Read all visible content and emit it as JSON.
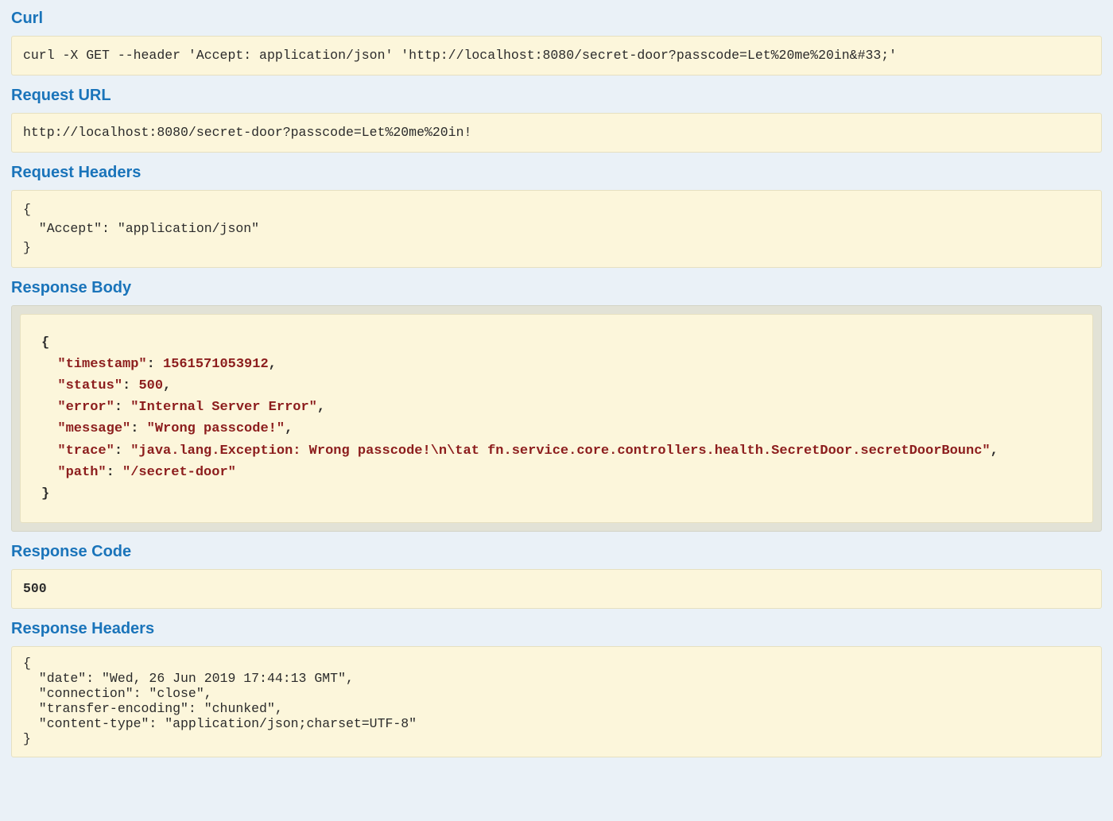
{
  "sections": {
    "curl": {
      "title": "Curl",
      "content": "curl -X GET --header 'Accept: application/json' 'http://localhost:8080/secret-door?passcode=Let%20me%20in&#33;'"
    },
    "requestUrl": {
      "title": "Request URL",
      "content": "http://localhost:8080/secret-door?passcode=Let%20me%20in!"
    },
    "requestHeaders": {
      "title": "Request Headers",
      "content": "{\n  \"Accept\": \"application/json\"\n}"
    },
    "responseBody": {
      "title": "Response Body",
      "json": {
        "timestamp": 1561571053912,
        "status": 500,
        "error": "Internal Server Error",
        "message": "Wrong passcode!",
        "trace": "java.lang.Exception: Wrong passcode!\\n\\tat fn.service.core.controllers.health.SecretDoor.secretDoorBounc",
        "path": "/secret-door"
      }
    },
    "responseCode": {
      "title": "Response Code",
      "content": "500"
    },
    "responseHeaders": {
      "title": "Response Headers",
      "content": "{\n  \"date\": \"Wed, 26 Jun 2019 17:44:13 GMT\",\n  \"connection\": \"close\",\n  \"transfer-encoding\": \"chunked\",\n  \"content-type\": \"application/json;charset=UTF-8\"\n}"
    }
  }
}
